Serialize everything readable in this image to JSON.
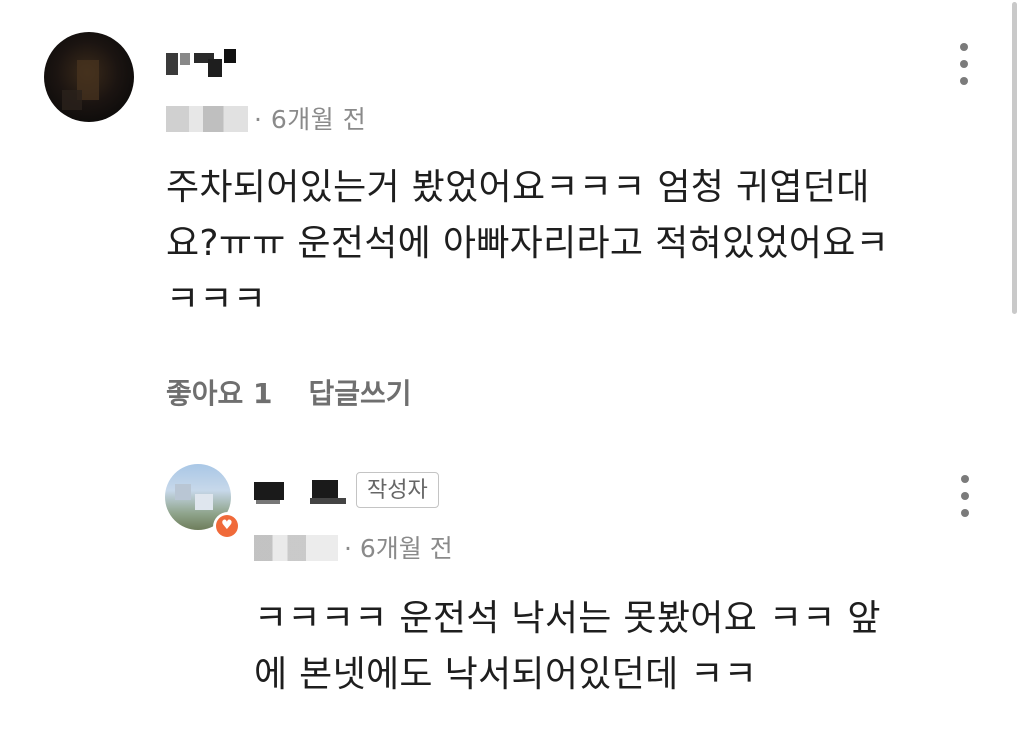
{
  "comment": {
    "time": "6개월 전",
    "body_lines": [
      "주차되어있는거 봤었어요ㅋㅋㅋ 엄청 귀엽던대",
      "요?ㅠㅠ 운전석에 아빠자리라고 적혀있었어요ㅋ",
      "ㅋㅋㅋ"
    ],
    "like_label": "좋아요 1",
    "reply_label": "답글쓰기"
  },
  "reply": {
    "author_tag": "작성자",
    "time": "6개월 전",
    "body_lines": [
      "ㅋㅋㅋㅋ 운전석 낙서는 못봤어요 ㅋㅋ 앞",
      "에 본넷에도 낙서되어있던데 ㅋㅋ"
    ]
  },
  "colors": {
    "text": "#1e1e1e",
    "meta": "#8a8a8a",
    "action": "#6f6f6f",
    "badge": "#f06a3a"
  },
  "icons": {
    "more_menu": "kebab-vertical-icon",
    "author_badge": "heart-badge-icon"
  }
}
